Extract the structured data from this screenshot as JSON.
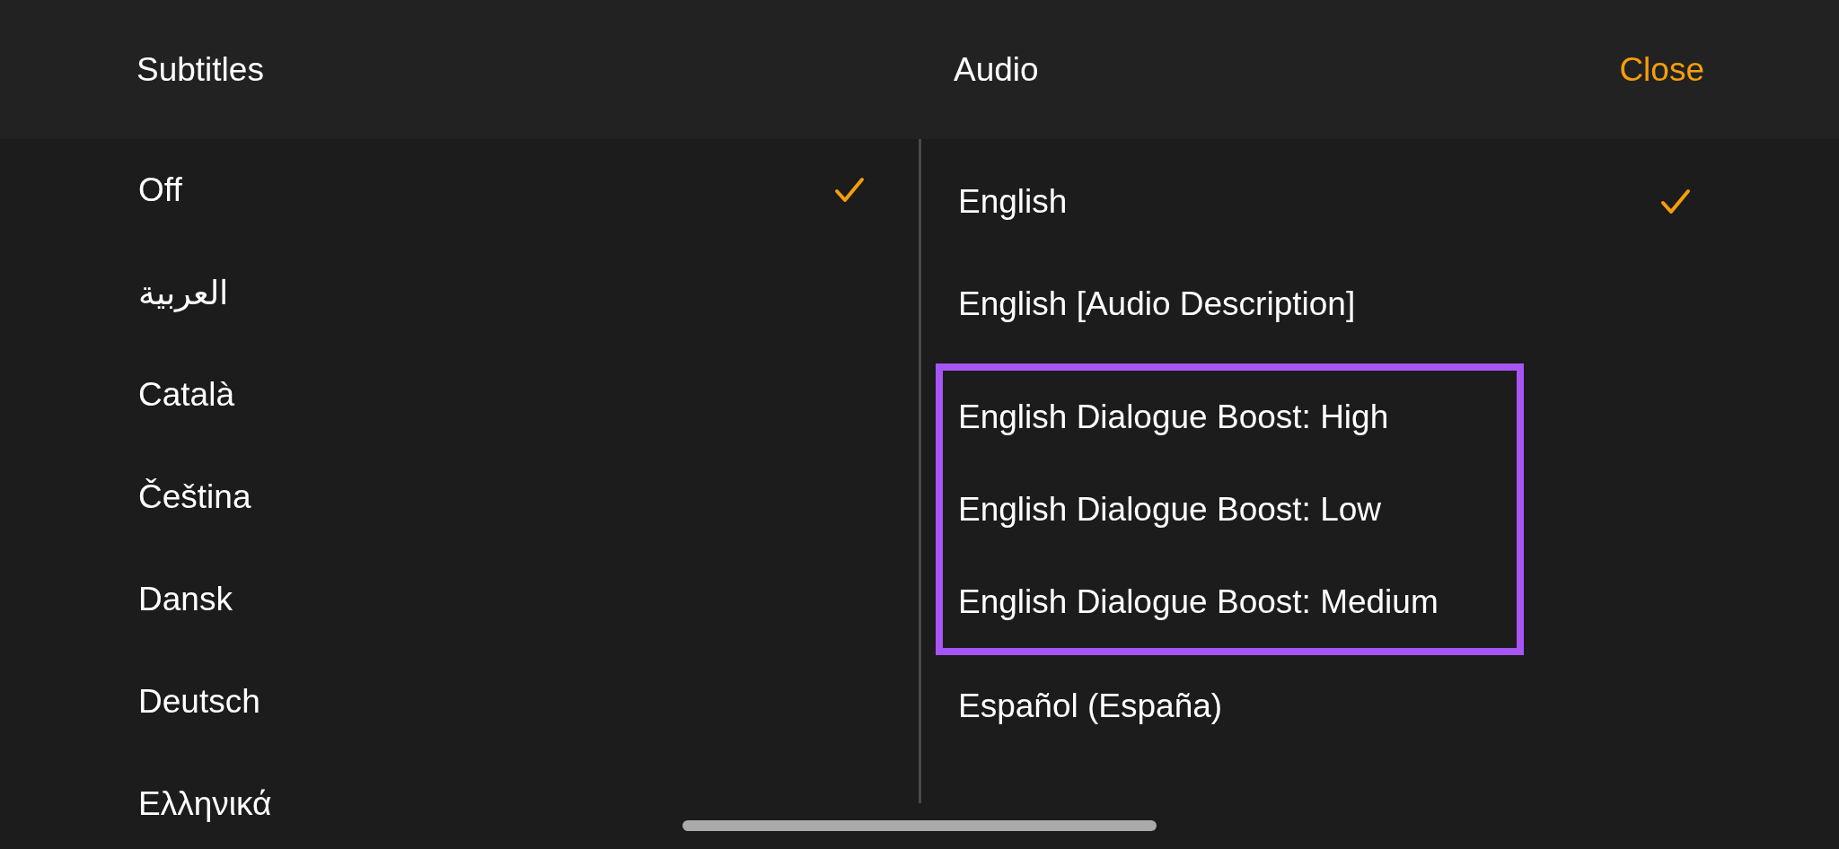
{
  "subtitles": {
    "title": "Subtitles",
    "items": [
      {
        "label": "Off",
        "selected": true
      },
      {
        "label": "العربية",
        "selected": false
      },
      {
        "label": "Català",
        "selected": false
      },
      {
        "label": "Čeština",
        "selected": false
      },
      {
        "label": "Dansk",
        "selected": false
      },
      {
        "label": "Deutsch",
        "selected": false
      },
      {
        "label": "Ελληνικά",
        "selected": false
      }
    ]
  },
  "audio": {
    "title": "Audio",
    "close": "Close",
    "items": [
      {
        "label": "English",
        "selected": true,
        "highlighted": false
      },
      {
        "label": "English [Audio Description]",
        "selected": false,
        "highlighted": false
      },
      {
        "label": "English Dialogue Boost: High",
        "selected": false,
        "highlighted": true
      },
      {
        "label": "English Dialogue Boost: Low",
        "selected": false,
        "highlighted": true
      },
      {
        "label": "English Dialogue Boost: Medium",
        "selected": false,
        "highlighted": true
      },
      {
        "label": "Español (España)",
        "selected": false,
        "highlighted": false
      }
    ]
  }
}
